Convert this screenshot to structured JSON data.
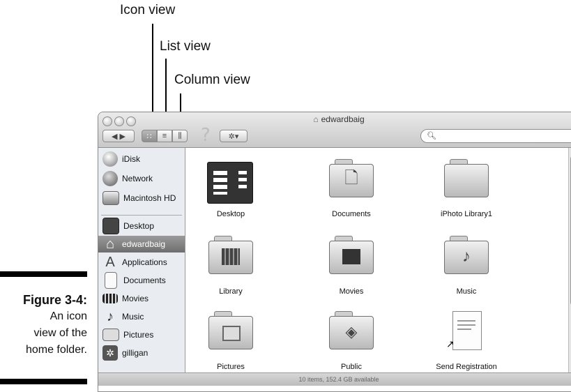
{
  "callouts": {
    "icon_view": "Icon view",
    "list_view": "List view",
    "column_view": "Column view"
  },
  "caption": {
    "number": "Figure 3-4:",
    "line1": "An icon",
    "line2": "view of the",
    "line3": "home folder."
  },
  "window": {
    "title": "edwardbaig",
    "title_icon": "home-icon",
    "search_placeholder": "",
    "status": "10 items, 152.4 GB available"
  },
  "toolbar": {
    "back_forward": "◀ ▶",
    "icon_view_glyph": "∷",
    "list_view_glyph": "≡",
    "column_view_glyph": "⫼",
    "action_glyph": "✲▾",
    "help_glyph": "?"
  },
  "sidebar": {
    "devices": [
      {
        "label": "iDisk",
        "icon": "idisk-icon"
      },
      {
        "label": "Network",
        "icon": "network-icon"
      },
      {
        "label": "Macintosh HD",
        "icon": "hard-drive-icon"
      }
    ],
    "places": [
      {
        "label": "Desktop",
        "icon": "desktop-icon"
      },
      {
        "label": "edwardbaig",
        "icon": "home-icon",
        "selected": true
      },
      {
        "label": "Applications",
        "icon": "applications-icon"
      },
      {
        "label": "Documents",
        "icon": "documents-icon"
      },
      {
        "label": "Movies",
        "icon": "movies-icon"
      },
      {
        "label": "Music",
        "icon": "music-icon"
      },
      {
        "label": "Pictures",
        "icon": "pictures-icon"
      },
      {
        "label": "gilligan",
        "icon": "gilligan-icon"
      }
    ]
  },
  "items": [
    {
      "label": "Desktop",
      "icon": "desktop-folder-icon"
    },
    {
      "label": "Documents",
      "icon": "documents-folder-icon"
    },
    {
      "label": "iPhoto Library1",
      "icon": "iphoto-library-folder-icon"
    },
    {
      "label": "Library",
      "icon": "library-folder-icon"
    },
    {
      "label": "Movies",
      "icon": "movies-folder-icon"
    },
    {
      "label": "Music",
      "icon": "music-folder-icon"
    },
    {
      "label": "Pictures",
      "icon": "pictures-folder-icon"
    },
    {
      "label": "Public",
      "icon": "public-folder-icon"
    },
    {
      "label": "Send Registration",
      "icon": "send-registration-icon"
    }
  ]
}
